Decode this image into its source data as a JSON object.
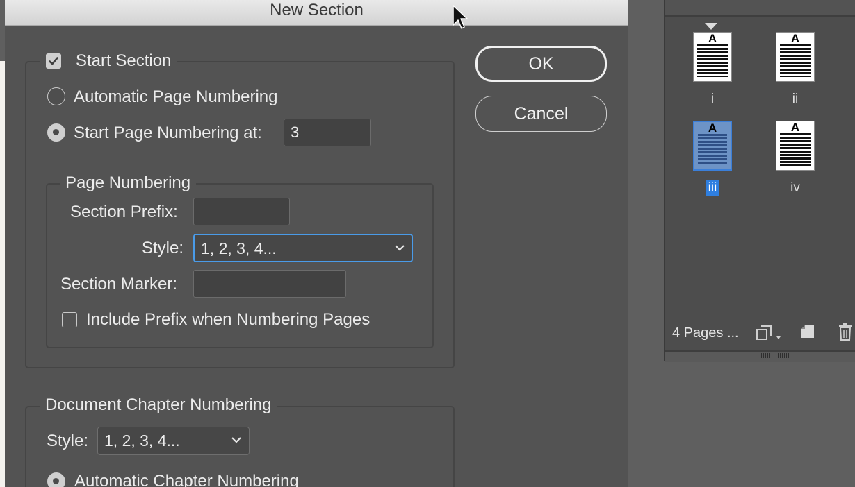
{
  "dialog": {
    "title": "New Section",
    "ok_label": "OK",
    "cancel_label": "Cancel",
    "start_section": {
      "label": "Start Section",
      "checked": true
    },
    "automatic_page_numbering": {
      "label": "Automatic Page Numbering",
      "selected": false
    },
    "start_page_numbering": {
      "label": "Start Page Numbering at:",
      "selected": true,
      "value": "3"
    },
    "page_numbering": {
      "legend": "Page Numbering",
      "section_prefix_label": "Section Prefix:",
      "section_prefix_value": "",
      "style_label": "Style:",
      "style_value": "1, 2, 3, 4...",
      "section_marker_label": "Section Marker:",
      "section_marker_value": "",
      "include_prefix_label": "Include Prefix when Numbering Pages",
      "include_prefix_checked": false
    },
    "chapter_numbering": {
      "legend": "Document Chapter Numbering",
      "style_label": "Style:",
      "style_value": "1, 2, 3, 4...",
      "automatic_label": "Automatic Chapter Numbering"
    }
  },
  "pages_panel": {
    "pages": [
      {
        "label": "i",
        "master": "A",
        "selected": false
      },
      {
        "label": "ii",
        "master": "A",
        "selected": false
      },
      {
        "label": "iii",
        "master": "A",
        "selected": true
      },
      {
        "label": "iv",
        "master": "A",
        "selected": false
      }
    ],
    "status": "4 Pages ...",
    "icons": [
      "edit-page-size-icon",
      "new-page-icon",
      "delete-page-icon"
    ]
  },
  "colors": {
    "dialog_bg": "#535353",
    "focus_ring": "#4a9be8",
    "page_selected": "#2f7fe0"
  }
}
